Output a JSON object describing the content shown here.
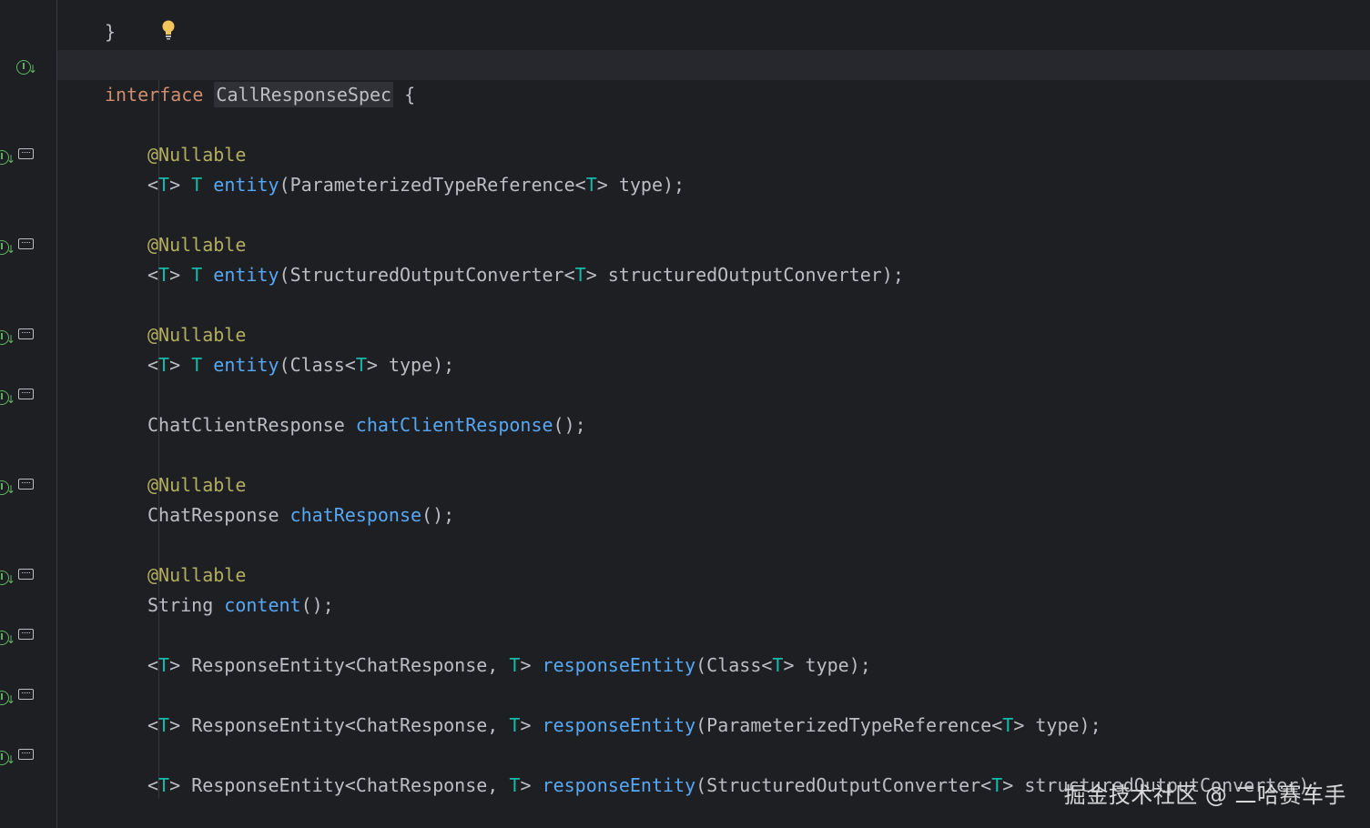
{
  "editor": {
    "top_brace": "}",
    "interface_keyword": "interface",
    "interface_name": "CallResponseSpec",
    "interface_open": " {",
    "close_brace": "}",
    "lines": [
      {
        "ann": "@Nullable"
      },
      {
        "tparam": "<",
        "T1": "T",
        "gt": ">",
        "ret": "T",
        "method": "entity",
        "args_before": "(ParameterizedTypeReference<",
        "argT": "T",
        "args_after": "> type);"
      },
      {
        "ann": "@Nullable"
      },
      {
        "method": "entity",
        "args_before": "(StructuredOutputConverter<",
        "argT": "T",
        "args_after": "> structuredOutputConverter);"
      },
      {
        "ann": "@Nullable"
      },
      {
        "method": "entity",
        "args_before": "(Class<",
        "argT": "T",
        "args_after": "> type);"
      },
      {
        "ret": "ChatClientResponse ",
        "method": "chatClientResponse",
        "args": "();"
      },
      {
        "ann": "@Nullable"
      },
      {
        "ret": "ChatResponse ",
        "method": "chatResponse",
        "args": "();"
      },
      {
        "ann": "@Nullable"
      },
      {
        "ret": "String ",
        "method": "content",
        "args": "();"
      },
      {
        "ret": "ResponseEntity<ChatResponse, ",
        "method": "responseEntity",
        "args_before": "(Class<",
        "argT": "T",
        "args_after": "> type);"
      },
      {
        "ret": "ResponseEntity<ChatResponse, ",
        "method": "responseEntity",
        "args_before": "(ParameterizedTypeReference<",
        "argT": "T",
        "args_after": "> type);"
      },
      {
        "ret": "ResponseEntity<ChatResponse, ",
        "method": "responseEntity",
        "args_before": "(StructuredOutputConverter<",
        "argT": "T",
        "args_after": "> structuredOutputConverter);"
      }
    ],
    "generic_open": "<",
    "generic_T": "T",
    "generic_close": "> ",
    "ret_T": "T",
    "space": " "
  },
  "gutter": {
    "interface_icon": "implemented-interface-icon",
    "method_icon": "implemented-method-icon",
    "signature_icon": "method-signature-icon",
    "interface_icon_letter": "I",
    "method_icon_letter": "I",
    "arrow": "↓"
  },
  "bulb_icon": "lightbulb-icon",
  "watermark": "掘金技术社区 @ 二哈赛车手",
  "colors": {
    "background": "#1e1f22",
    "keyword": "#cf8e6d",
    "annotation": "#b3ae60",
    "method": "#56a8f5",
    "type_param": "#16baac",
    "plain": "#bcbec4",
    "gutter_icon": "#5fb865"
  }
}
